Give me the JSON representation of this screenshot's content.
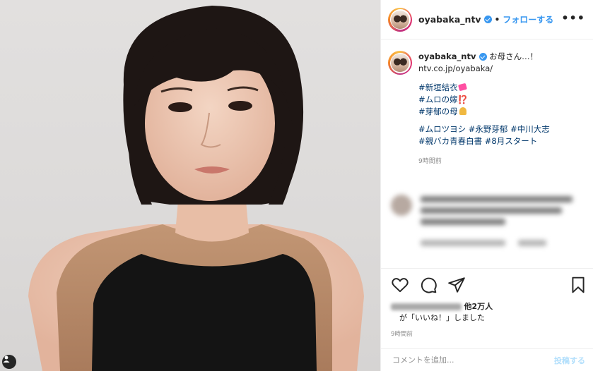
{
  "header": {
    "username": "oyabaka_ntv",
    "dot": "•",
    "follow_label": "フォローする",
    "more_label": "•••"
  },
  "caption": {
    "username": "oyabaka_ntv",
    "text": "お母さん…！",
    "link": "ntv.co.jp/oyabaka/",
    "tags": [
      "#新垣結衣",
      "#ムロの嫁",
      "#芽郁の母",
      "#ムロツヨシ #永野芽郁 #中川大志",
      "#親バカ青春白書 #8月スタート"
    ],
    "tag2_emoji": "⁉️",
    "time": "9時間前"
  },
  "likes": {
    "count_text": "他2万人",
    "line2": "が「いいね！」しました"
  },
  "post_time": "9時間前",
  "comment_box": {
    "placeholder": "コメントを追加...",
    "post_label": "投稿する"
  },
  "icons": {
    "like": "heart-icon",
    "comment": "comment-icon",
    "share": "share-icon",
    "save": "bookmark-icon",
    "tag": "user-tag-icon"
  },
  "colors": {
    "accent": "#3897f0",
    "hashtag": "#00376b",
    "muted": "#8e8e8e"
  }
}
